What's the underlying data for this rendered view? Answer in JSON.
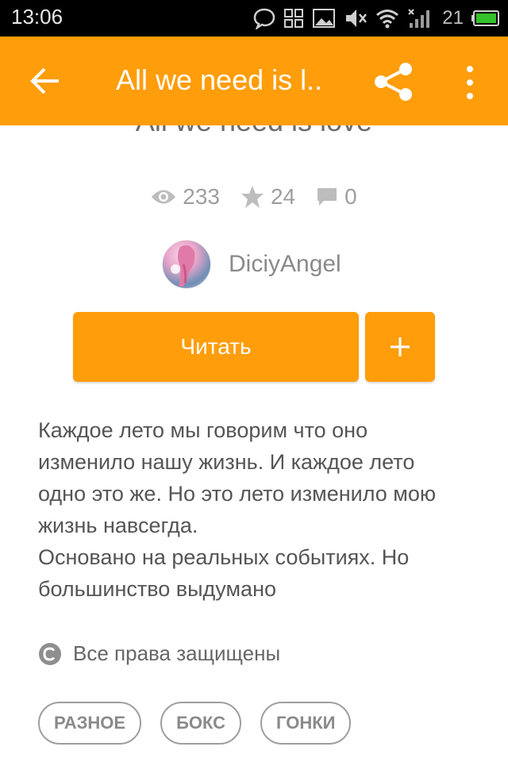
{
  "status_bar": {
    "time": "13:06",
    "battery_level": "21",
    "icons": [
      "chat-bubble-icon",
      "grid-icon",
      "image-icon",
      "mute-icon",
      "wifi-icon",
      "signal-icon",
      "battery-icon"
    ]
  },
  "app_bar": {
    "title": "All we need is l..",
    "back_icon": "arrow-left-icon",
    "share_icon": "share-icon",
    "more_icon": "more-vertical-icon",
    "color": "#ff9d0a"
  },
  "story": {
    "title": "All we need is love",
    "views": "233",
    "votes": "24",
    "comments": "0",
    "author": "DiciyAngel",
    "read_label": "Читать",
    "add_label": "+",
    "description_lines": [
      "Каждое лето мы говорим что оно",
      "изменило нашу жизнь. И каждое лето",
      "одно это же. Но это лето изменило мою",
      "жизнь навсегда.",
      "Основано на реальных событиях. Но",
      "большинство выдумано"
    ],
    "copyright": "Все права защищены",
    "tags": [
      "РАЗНОЕ",
      "БОКС",
      "ГОНКИ"
    ]
  }
}
